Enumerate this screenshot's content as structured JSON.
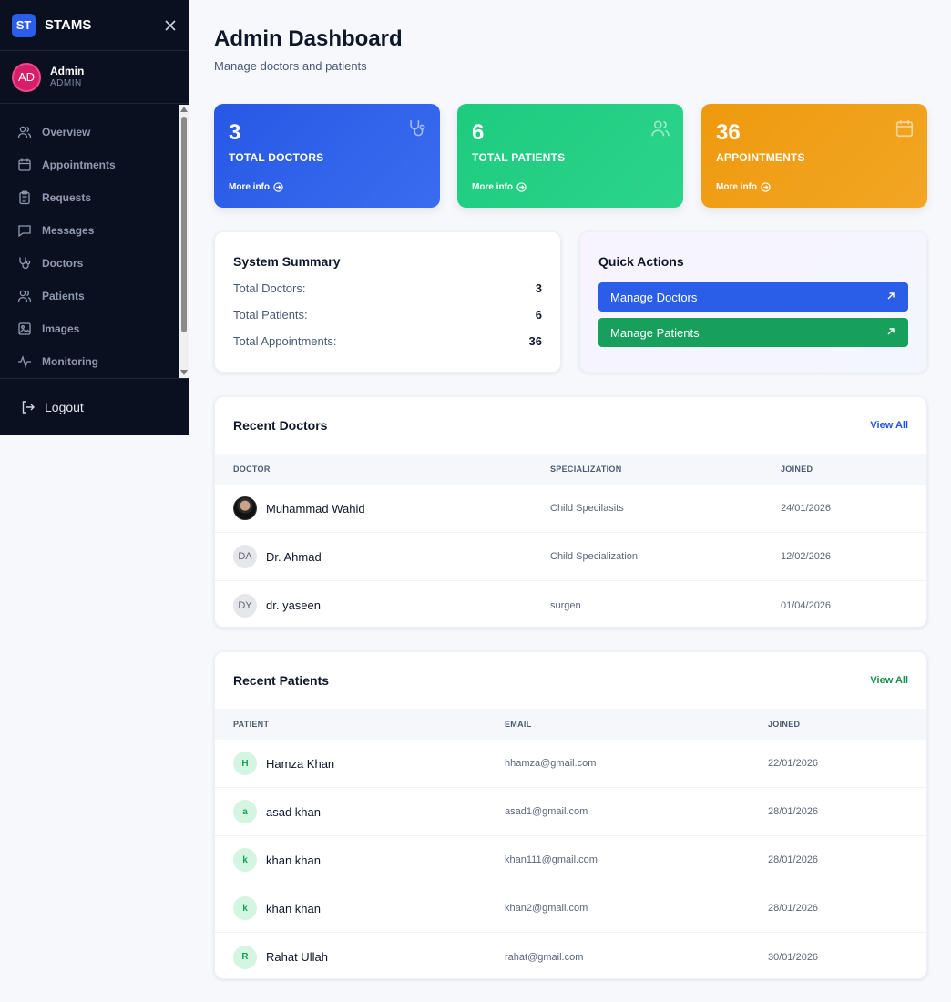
{
  "sidebar": {
    "brand_logo": "ST",
    "brand_name": "STAMS",
    "user": {
      "initials": "AD",
      "name": "Admin",
      "role": "ADMIN"
    },
    "items": [
      {
        "label": "Overview",
        "icon": "users-icon"
      },
      {
        "label": "Appointments",
        "icon": "calendar-icon"
      },
      {
        "label": "Requests",
        "icon": "clipboard-icon"
      },
      {
        "label": "Messages",
        "icon": "message-icon"
      },
      {
        "label": "Doctors",
        "icon": "stethoscope-icon"
      },
      {
        "label": "Patients",
        "icon": "users-icon"
      },
      {
        "label": "Images",
        "icon": "image-icon"
      },
      {
        "label": "Monitoring",
        "icon": "activity-icon"
      }
    ],
    "logout_label": "Logout"
  },
  "header": {
    "title": "Admin Dashboard",
    "subtitle": "Manage doctors and patients"
  },
  "stats": [
    {
      "value": "3",
      "label": "TOTAL DOCTORS",
      "more": "More info",
      "color": "#2b5ee8",
      "icon": "stethoscope-icon"
    },
    {
      "value": "6",
      "label": "TOTAL PATIENTS",
      "more": "More info",
      "color": "#22cc80",
      "icon": "users-icon"
    },
    {
      "value": "36",
      "label": "APPOINTMENTS",
      "more": "More info",
      "color": "#f0a018",
      "icon": "calendar-icon"
    }
  ],
  "summary": {
    "title": "System Summary",
    "rows": [
      {
        "label": "Total Doctors:",
        "value": "3"
      },
      {
        "label": "Total Patients:",
        "value": "6"
      },
      {
        "label": "Total Appointments:",
        "value": "36"
      }
    ]
  },
  "quick_actions": {
    "title": "Quick Actions",
    "manage_doctors": "Manage Doctors",
    "manage_patients": "Manage Patients"
  },
  "recent_doctors": {
    "title": "Recent Doctors",
    "view_all": "View All",
    "columns": [
      "DOCTOR",
      "SPECIALIZATION",
      "JOINED"
    ],
    "rows": [
      {
        "avatar": "",
        "name": "Muhammad Wahid",
        "specialization": "Child Specilasits",
        "joined": "24/01/2026"
      },
      {
        "avatar": "DA",
        "name": "Dr. Ahmad",
        "specialization": "Child Specialization",
        "joined": "12/02/2026"
      },
      {
        "avatar": "DY",
        "name": "dr. yaseen",
        "specialization": "surgen",
        "joined": "01/04/2026"
      }
    ]
  },
  "recent_patients": {
    "title": "Recent Patients",
    "view_all": "View All",
    "columns": [
      "PATIENT",
      "EMAIL",
      "JOINED"
    ],
    "rows": [
      {
        "avatar": "H",
        "name": "Hamza Khan",
        "email": "hhamza@gmail.com",
        "joined": "22/01/2026"
      },
      {
        "avatar": "a",
        "name": "asad khan",
        "email": "asad1@gmail.com",
        "joined": "28/01/2026"
      },
      {
        "avatar": "k",
        "name": "khan khan",
        "email": "khan111@gmail.com",
        "joined": "28/01/2026"
      },
      {
        "avatar": "k",
        "name": "khan khan",
        "email": "khan2@gmail.com",
        "joined": "28/01/2026"
      },
      {
        "avatar": "R",
        "name": "Rahat Ullah",
        "email": "rahat@gmail.com",
        "joined": "30/01/2026"
      }
    ]
  }
}
